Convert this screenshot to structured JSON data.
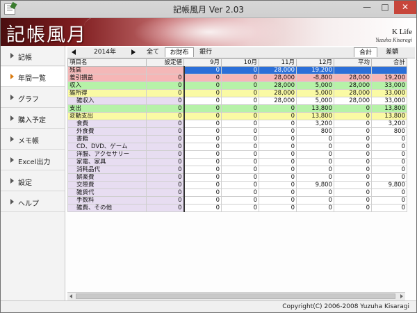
{
  "window": {
    "title": "記帳風月 Ver 2.03",
    "min_label": "—",
    "max_label": "□",
    "close_label": "✕"
  },
  "banner": {
    "logo": "記帳風月",
    "brand": "K Life",
    "author": "Yuzuha Kisaragi"
  },
  "sidebar": {
    "items": [
      {
        "label": "記帳",
        "active": false
      },
      {
        "label": "年間一覧",
        "active": true
      },
      {
        "label": "グラフ",
        "active": false
      },
      {
        "label": "購入予定",
        "active": false
      },
      {
        "label": "メモ帳",
        "active": false
      },
      {
        "label": "Excel出力",
        "active": false
      },
      {
        "label": "設定",
        "active": false
      },
      {
        "label": "ヘルプ",
        "active": false
      }
    ]
  },
  "toolbar": {
    "year": "2014年",
    "filters": [
      "全て",
      "お財布",
      "銀行"
    ],
    "right_tabs": [
      "合計",
      "差額"
    ]
  },
  "table": {
    "headers": [
      "項目名",
      "設定値",
      "9月",
      "10月",
      "11月",
      "12月",
      "平均",
      "合計"
    ],
    "rows": [
      {
        "style": "blue",
        "cells": [
          "残高",
          "",
          "0",
          "0",
          "28,000",
          "19,200",
          "",
          ""
        ]
      },
      {
        "style": "pink",
        "cells": [
          "差引損益",
          "0",
          "0",
          "0",
          "28,000",
          "-8,800",
          "28,000",
          "19,200"
        ]
      },
      {
        "style": "green",
        "cells": [
          "収入",
          "0",
          "0",
          "0",
          "28,000",
          "5,000",
          "28,000",
          "33,000"
        ]
      },
      {
        "style": "yellow",
        "cells": [
          "雑所得",
          "0",
          "0",
          "0",
          "28,000",
          "5,000",
          "28,000",
          "33,000"
        ]
      },
      {
        "style": "sub",
        "cells": [
          "雑収入",
          "0",
          "0",
          "0",
          "28,000",
          "5,000",
          "28,000",
          "33,000"
        ]
      },
      {
        "style": "green",
        "cells": [
          "支出",
          "0",
          "0",
          "0",
          "0",
          "13,800",
          "0",
          "13,800"
        ]
      },
      {
        "style": "yellow",
        "cells": [
          "変動支出",
          "0",
          "0",
          "0",
          "0",
          "13,800",
          "0",
          "13,800"
        ]
      },
      {
        "style": "sub",
        "cells": [
          "食費",
          "0",
          "0",
          "0",
          "0",
          "3,200",
          "0",
          "3,200"
        ]
      },
      {
        "style": "sub",
        "cells": [
          "外食費",
          "0",
          "0",
          "0",
          "0",
          "800",
          "0",
          "800"
        ]
      },
      {
        "style": "sub",
        "cells": [
          "書籍",
          "0",
          "0",
          "0",
          "0",
          "0",
          "0",
          "0"
        ]
      },
      {
        "style": "sub",
        "cells": [
          "CD、DVD、ゲーム",
          "0",
          "0",
          "0",
          "0",
          "0",
          "0",
          "0"
        ]
      },
      {
        "style": "sub",
        "cells": [
          "洋服、アクセサリー",
          "0",
          "0",
          "0",
          "0",
          "0",
          "0",
          "0"
        ]
      },
      {
        "style": "sub",
        "cells": [
          "家電、家具",
          "0",
          "0",
          "0",
          "0",
          "0",
          "0",
          "0"
        ]
      },
      {
        "style": "sub",
        "cells": [
          "消耗品代",
          "0",
          "0",
          "0",
          "0",
          "0",
          "0",
          "0"
        ]
      },
      {
        "style": "sub",
        "cells": [
          "娯楽費",
          "0",
          "0",
          "0",
          "0",
          "0",
          "0",
          "0"
        ]
      },
      {
        "style": "sub",
        "cells": [
          "交際費",
          "0",
          "0",
          "0",
          "0",
          "9,800",
          "0",
          "9,800"
        ]
      },
      {
        "style": "sub",
        "cells": [
          "雑貨代",
          "0",
          "0",
          "0",
          "0",
          "0",
          "0",
          "0"
        ]
      },
      {
        "style": "sub",
        "cells": [
          "手数料",
          "0",
          "0",
          "0",
          "0",
          "0",
          "0",
          "0"
        ]
      },
      {
        "style": "sub",
        "cells": [
          "雑費、その他",
          "0",
          "0",
          "0",
          "0",
          "0",
          "0",
          "0"
        ]
      }
    ]
  },
  "status": {
    "copyright": "Copyright(C) 2006-2008 Yuzuha Kisaragi"
  },
  "colors": {
    "balance_highlight": "#2b6fd8",
    "profit_row": "#f6b6b6",
    "income_row": "#b6f2a8",
    "category_row": "#fafaa4",
    "item_name_bg": "#e7ddf1",
    "active_arrow": "#d97a10"
  }
}
